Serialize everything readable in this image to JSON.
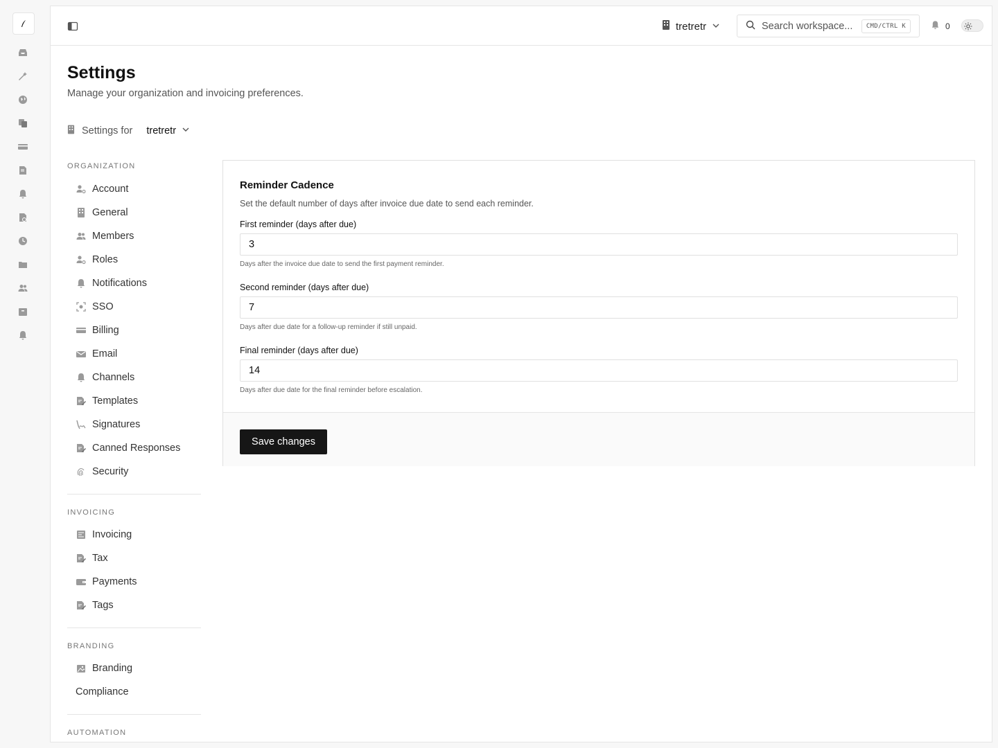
{
  "rail": {
    "icons": [
      "logo-icon",
      "inbox-icon",
      "magic-wand-icon",
      "globe-icon",
      "copy-icon",
      "credit-card-icon",
      "document-icon",
      "bell-icon",
      "document-refresh-icon",
      "clock-icon",
      "folder-icon",
      "users-icon",
      "box-icon",
      "bell-icon"
    ]
  },
  "topbar": {
    "org_name": "tretretr",
    "search_placeholder": "Search workspace...",
    "search_shortcut": "CMD/CTRL K",
    "notification_count": "0"
  },
  "page": {
    "title": "Settings",
    "subtitle": "Manage your organization and invoicing preferences.",
    "settings_for_label": "Settings for",
    "settings_for_org": "tretretr"
  },
  "nav": {
    "organization": {
      "heading": "Organization",
      "items": [
        {
          "label": "Account",
          "icon": "user-gear-icon"
        },
        {
          "label": "General",
          "icon": "building-icon"
        },
        {
          "label": "Members",
          "icon": "users-icon"
        },
        {
          "label": "Roles",
          "icon": "user-gear-icon"
        },
        {
          "label": "Notifications",
          "icon": "bell-icon"
        },
        {
          "label": "SSO",
          "icon": "scan-icon"
        },
        {
          "label": "Billing",
          "icon": "credit-card-icon"
        },
        {
          "label": "Email",
          "icon": "mail-icon"
        },
        {
          "label": "Channels",
          "icon": "bell-icon"
        },
        {
          "label": "Templates",
          "icon": "document-edit-icon"
        },
        {
          "label": "Signatures",
          "icon": "signature-icon"
        },
        {
          "label": "Canned Responses",
          "icon": "document-edit-icon"
        },
        {
          "label": "Security",
          "icon": "fingerprint-icon"
        }
      ]
    },
    "invoicing": {
      "heading": "Invoicing",
      "items": [
        {
          "label": "Invoicing",
          "icon": "receipt-icon"
        },
        {
          "label": "Tax",
          "icon": "document-edit-icon"
        },
        {
          "label": "Payments",
          "icon": "wallet-icon"
        },
        {
          "label": "Tags",
          "icon": "document-edit-icon"
        }
      ]
    },
    "branding": {
      "heading": "Branding",
      "items": [
        {
          "label": "Branding",
          "icon": "image-icon"
        },
        {
          "label": "Compliance",
          "icon": ""
        }
      ]
    },
    "automation": {
      "heading": "Automation"
    }
  },
  "card": {
    "title": "Reminder Cadence",
    "description": "Set the default number of days after invoice due date to send each reminder.",
    "fields": [
      {
        "label": "First reminder (days after due)",
        "value": "3",
        "help": "Days after the invoice due date to send the first payment reminder."
      },
      {
        "label": "Second reminder (days after due)",
        "value": "7",
        "help": "Days after due date for a follow-up reminder if still unpaid."
      },
      {
        "label": "Final reminder (days after due)",
        "value": "14",
        "help": "Days after due date for the final reminder before escalation."
      }
    ],
    "save_label": "Save changes"
  }
}
